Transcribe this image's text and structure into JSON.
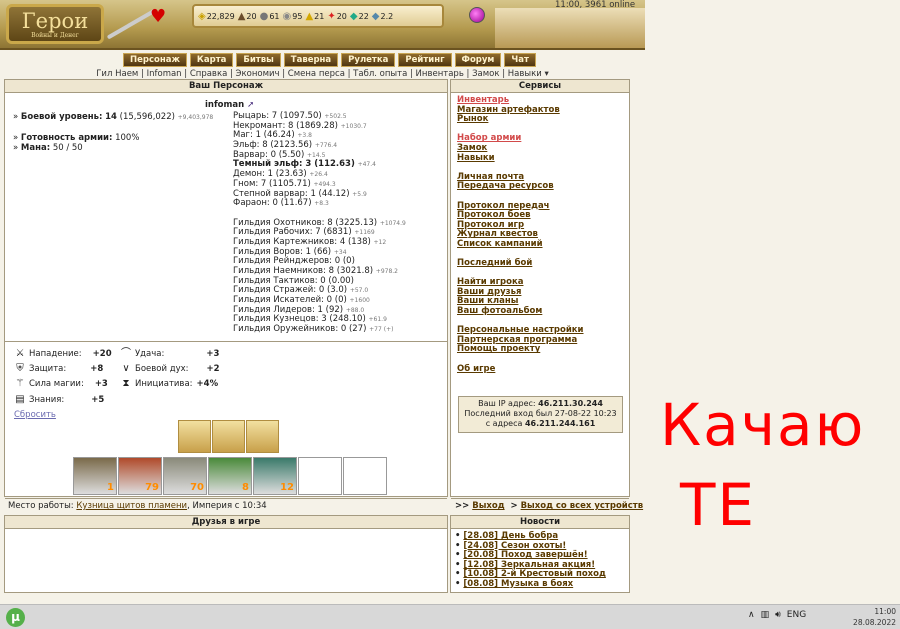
{
  "header": {
    "logo_title": "Герои",
    "logo_subtitle": "Войны и Денег",
    "status": "11:00, 3961 online",
    "resources": [
      {
        "icon": "gold-icon",
        "glyph": "◈",
        "value": "22,829"
      },
      {
        "icon": "wood-icon",
        "glyph": "▲",
        "value": "20"
      },
      {
        "icon": "ore-icon",
        "glyph": "●",
        "value": "61"
      },
      {
        "icon": "mercury-icon",
        "glyph": "◉",
        "value": "95"
      },
      {
        "icon": "sulfur-icon",
        "glyph": "▲",
        "value": "21"
      },
      {
        "icon": "crystal-icon",
        "glyph": "✦",
        "value": "20"
      },
      {
        "icon": "gems-icon",
        "glyph": "◆",
        "value": "22"
      },
      {
        "icon": "diamond-icon",
        "glyph": "◆",
        "value": "2.2"
      }
    ],
    "nav": [
      "Персонаж",
      "Карта",
      "Битвы",
      "Таверна",
      "Рулетка",
      "Рейтинг",
      "Форум",
      "Чат"
    ],
    "submenu": "Гил Наем | Infoman | Справка | Экономич | Смена перса | Табл. опыта | Инвентарь | Замок | Навыки ▾"
  },
  "character": {
    "panel_title": "Ваш Персонаж",
    "name": "infoman",
    "combat_level_label": "Боевой уровень:",
    "combat_level": "14",
    "combat_exp": "(15,596,022)",
    "combat_exp_small": "+9,403,978",
    "army_label": "Готовность армии:",
    "army_value": "100%",
    "mana_label": "Мана:",
    "mana_value": "50 / 50",
    "races": [
      {
        "text": "Рыцарь: 7 (1097.50)",
        "small": "+502.5"
      },
      {
        "text": "Некромант: 8 (1869.28)",
        "small": "+1030.7"
      },
      {
        "text": "Маг: 1 (46.24)",
        "small": "+3.8"
      },
      {
        "text": "Эльф: 8 (2123.56)",
        "small": "+776.4"
      },
      {
        "text": "Варвар: 0 (5.50)",
        "small": "+14.5"
      },
      {
        "text": "Темный эльф: 3 (112.63)",
        "small": "+47.4",
        "bold": true
      },
      {
        "text": "Демон: 1 (23.63)",
        "small": "+26.4"
      },
      {
        "text": "Гном: 7 (1105.71)",
        "small": "+494.3"
      },
      {
        "text": "Степной варвар: 1 (44.12)",
        "small": "+5.9"
      },
      {
        "text": "Фараон: 0 (11.67)",
        "small": "+8.3"
      },
      {
        "text": "",
        "small": ""
      },
      {
        "text": "Гильдия Охотников: 8 (3225.13)",
        "small": "+1074.9"
      },
      {
        "text": "Гильдия Рабочих: 7 (6831)",
        "small": "+1169"
      },
      {
        "text": "Гильдия Картежников: 4 (138)",
        "small": "+12"
      },
      {
        "text": "Гильдия Воров: 1 (66)",
        "small": "+34"
      },
      {
        "text": "Гильдия Рейнджеров: 0 (0)",
        "small": ""
      },
      {
        "text": "Гильдия Наемников: 8 (3021.8)",
        "small": "+978.2"
      },
      {
        "text": "Гильдия Тактиков: 0 (0.00)",
        "small": ""
      },
      {
        "text": "Гильдия Стражей: 0 (3.0)",
        "small": "+57.0"
      },
      {
        "text": "Гильдия Искателей: 0 (0)",
        "small": "+1600"
      },
      {
        "text": "Гильдия Лидеров: 1 (92)",
        "small": "+88.0"
      },
      {
        "text": "Гильдия Кузнецов: 3 (248.10)",
        "small": "+61.9"
      },
      {
        "text": "Гильдия Оружейников: 0 (27)",
        "small": "+77 (+)"
      }
    ],
    "attributes": {
      "attack_label": "Нападение:",
      "attack": "+20",
      "defense_label": "Защита:",
      "defense": "+8",
      "power_label": "Сила магии:",
      "power": "+3",
      "knowledge_label": "Знания:",
      "knowledge": "+5",
      "luck_label": "Удача:",
      "luck": "+3",
      "morale_label": "Боевой дух:",
      "morale": "+2",
      "initiative_label": "Инициатива:",
      "initiative": "+4%"
    },
    "reset_link": "Сбросить",
    "army_counts": [
      "1",
      "79",
      "70",
      "8",
      "12",
      "",
      ""
    ],
    "work_label": "Место работы:",
    "work_place": "Кузница щитов пламени",
    "work_since": ", Империя с 10:34"
  },
  "services": {
    "panel_title": "Сервисы",
    "groups": [
      [
        "Инвентарь",
        "Магазин артефактов",
        "Рынок"
      ],
      [
        "Набор армии",
        "Замок",
        "Навыки"
      ],
      [
        "Личная почта",
        "Передача ресурсов"
      ],
      [
        "Протокол передач",
        "Протокол боев",
        "Протокол игр",
        "Журнал квестов",
        "Список кампаний"
      ],
      [
        "Последний бой"
      ],
      [
        "Найти игрока",
        "Ваши друзья",
        "Ваши кланы",
        "Ваш фотоальбом"
      ],
      [
        "Персональные настройки",
        "Партнерская программа",
        "Помощь проекту"
      ],
      [
        "Об игре"
      ]
    ],
    "ip_label": "Ваш IP адрес:",
    "ip": "46.211.30.244",
    "last_login_label": "Последний вход был 27-08-22 10:23",
    "last_ip_label": "с адреса",
    "last_ip": "46.211.244.161",
    "logout": "Выход",
    "logout_all": "Выход со всех устройств"
  },
  "friends": {
    "panel_title": "Друзья в игре"
  },
  "news": {
    "panel_title": "Новости",
    "items": [
      "[28.08] День бобра",
      "[24.08] Сезон охоты!",
      "[20.08] Поход завершён!",
      "[12.08] Зеркальная акция!",
      "[10.08] 2-й Крестовый поход",
      "[08.08] Музыка в боях"
    ]
  },
  "annotation": {
    "line1": "Качаю",
    "line2": "ТЕ"
  },
  "taskbar": {
    "lang": "ENG",
    "time": "11:00",
    "date": "28.08.2022"
  }
}
